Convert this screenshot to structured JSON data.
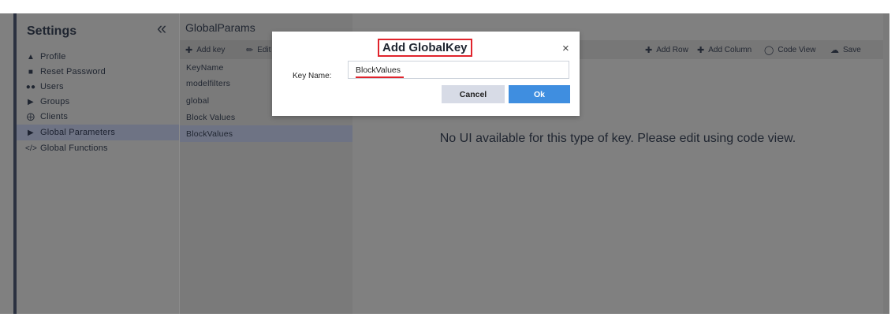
{
  "sidebar": {
    "title": "Settings",
    "collapse_icon": "«",
    "items": [
      {
        "icon": "user-icon",
        "glyph": "👤",
        "label": "Profile"
      },
      {
        "icon": "lock-icon",
        "glyph": "🔒",
        "label": "Reset Password"
      },
      {
        "icon": "users-icon",
        "glyph": "👥",
        "label": "Users"
      },
      {
        "icon": "tag-icon",
        "glyph": "▶",
        "label": "Groups"
      },
      {
        "icon": "life-ring-icon",
        "glyph": "◎",
        "label": "Clients"
      },
      {
        "icon": "tag-icon",
        "glyph": "▶",
        "label": "Global Parameters",
        "active": true
      },
      {
        "icon": "code-icon",
        "glyph": "</>",
        "label": "Global Functions"
      }
    ]
  },
  "keys_panel": {
    "header": "GlobalParams",
    "toolbar": {
      "add_key": "Add key",
      "edit": "Edit"
    },
    "rows": [
      "KeyName",
      "modelfilters",
      "global",
      "Block Values",
      "BlockValues"
    ],
    "active_row": "BlockValues"
  },
  "main": {
    "toolbar": {
      "add_row": "Add Row",
      "add_column": "Add Column",
      "code_view": "Code View",
      "save": "Save"
    },
    "message": "No UI available for this type of key. Please edit using code view."
  },
  "modal": {
    "title": "Add GlobalKey",
    "close": "×",
    "field_label": "Key Name:",
    "field_value": "BlockValues",
    "cancel": "Cancel",
    "ok": "Ok"
  },
  "colors": {
    "accent": "#3f8ee0",
    "highlight": "#e0242c",
    "active_row": "#6e7384"
  }
}
